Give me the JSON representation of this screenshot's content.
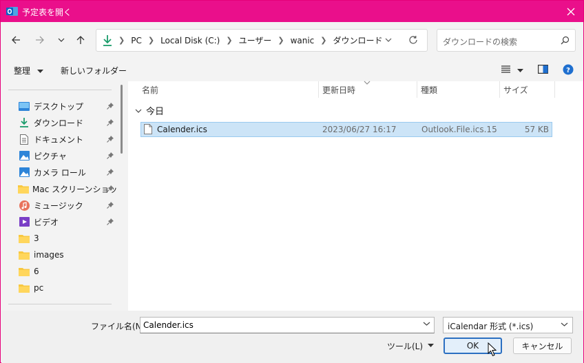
{
  "window": {
    "title": "予定表を開く",
    "accent": "#ea0f8b"
  },
  "address": {
    "crumbs": [
      "PC",
      "Local Disk (C:)",
      "ユーザー",
      "wanic",
      "ダウンロード"
    ]
  },
  "search": {
    "placeholder": "ダウンロードの検索"
  },
  "commandbar": {
    "organize": "整理",
    "new_folder": "新しいフォルダー"
  },
  "nav": {
    "items": [
      {
        "label": "デスクトップ",
        "icon": "desktop-icon",
        "pinned": true
      },
      {
        "label": "ダウンロード",
        "icon": "download-icon",
        "pinned": true
      },
      {
        "label": "ドキュメント",
        "icon": "document-icon",
        "pinned": true
      },
      {
        "label": "ピクチャ",
        "icon": "pictures-icon",
        "pinned": true
      },
      {
        "label": "カメラ ロール",
        "icon": "camera-roll-icon",
        "pinned": true
      },
      {
        "label": "Mac スクリーンショット",
        "icon": "folder-icon",
        "pinned": true
      },
      {
        "label": "ミュージック",
        "icon": "music-icon",
        "pinned": true
      },
      {
        "label": "ビデオ",
        "icon": "video-icon",
        "pinned": true
      },
      {
        "label": "3",
        "icon": "folder-icon",
        "pinned": false
      },
      {
        "label": "images",
        "icon": "folder-icon",
        "pinned": false
      },
      {
        "label": "6",
        "icon": "folder-icon",
        "pinned": false
      },
      {
        "label": "pc",
        "icon": "folder-icon",
        "pinned": false
      }
    ]
  },
  "filelist": {
    "columns": [
      "名前",
      "更新日時",
      "種類",
      "サイズ"
    ],
    "group": "今日",
    "rows": [
      {
        "name": "Calender.ics",
        "modified": "2023/06/27 16:17",
        "type": "Outlook.File.ics.15",
        "size": "57 KB",
        "selected": true
      }
    ]
  },
  "bottom": {
    "filename_label": "ファイル名(N):",
    "filename_value": "Calender.ics",
    "filetype": "iCalendar 形式 (*.ics)",
    "tools": "ツール(L)",
    "ok": "OK",
    "cancel": "キャンセル"
  }
}
